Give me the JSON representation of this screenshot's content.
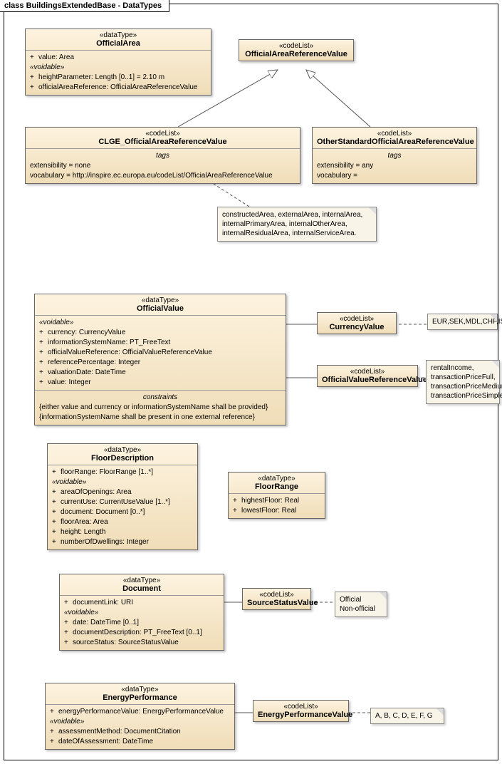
{
  "frame": {
    "title": "class BuildingsExtendedBase - DataTypes"
  },
  "officialArea": {
    "stereo": "«dataType»",
    "name": "OfficialArea",
    "attrs": [
      "value: Area"
    ],
    "voidableLabel": "«voidable»",
    "voidable": [
      "heightParameter: Length [0..1] = 2.10 m",
      "officialAreaReference: OfficialAreaReferenceValue"
    ]
  },
  "oarv": {
    "stereo": "«codeList»",
    "name": "OfficialAreaReferenceValue"
  },
  "clge": {
    "stereo": "«codeList»",
    "name": "CLGE_OfficialAreaReferenceValue",
    "tagsLabel": "tags",
    "tags": [
      "extensibility = none",
      "vocabulary = http://inspire.ec.europa.eu/codeList/OfficialAreaReferenceValue"
    ]
  },
  "other": {
    "stereo": "«codeList»",
    "name": "OtherStandardOfficialAreaReferenceValue",
    "tagsLabel": "tags",
    "tags": [
      "extensibility = any",
      "vocabulary ="
    ]
  },
  "areaNote": "constructedArea, externalArea, internalArea, internalPrimaryArea, internalOtherArea, internalResidualArea, internalServiceArea.",
  "officialValue": {
    "stereo": "«dataType»",
    "name": "OfficialValue",
    "voidableLabel": "«voidable»",
    "voidable": [
      "currency: CurrencyValue",
      "informationSystemName: PT_FreeText",
      "officialValueReference: OfficialValueReferenceValue",
      "referencePercentage: Integer",
      "valuationDate: DateTime",
      "value: Integer"
    ],
    "constraintsLabel": "constraints",
    "constraints": [
      "{either value and currency or informationSystemName shall be provided}",
      "{informationSystemName shall be present in one external reference}"
    ]
  },
  "currency": {
    "stereo": "«codeList»",
    "name": "CurrencyValue"
  },
  "currencyNote": "EUR,SEK,MDL,CHF,ISK,GBP,RUB,RSD",
  "ovrv": {
    "stereo": "«codeList»",
    "name": "OfficialValueReferenceValue"
  },
  "ovrvNote": "rentalIncome, transactionPriceFull, transactionPriceMedium, transactionPriceSimple",
  "floorDesc": {
    "stereo": "«dataType»",
    "name": "FloorDescription",
    "attrs": [
      "floorRange: FloorRange [1..*]"
    ],
    "voidableLabel": "«voidable»",
    "voidable": [
      "areaOfOpenings: Area",
      "currentUse: CurrentUseValue [1..*]",
      "document: Document [0..*]",
      "floorArea: Area",
      "height: Length",
      "numberOfDwellings: Integer"
    ]
  },
  "floorRange": {
    "stereo": "«dataType»",
    "name": "FloorRange",
    "attrs": [
      "highestFloor: Real",
      "lowestFloor: Real"
    ]
  },
  "document": {
    "stereo": "«dataType»",
    "name": "Document",
    "attrs": [
      "documentLink: URI"
    ],
    "voidableLabel": "«voidable»",
    "voidable": [
      "date: DateTime [0..1]",
      "documentDescription: PT_FreeText [0..1]",
      "sourceStatus: SourceStatusValue"
    ]
  },
  "sourceStatus": {
    "stereo": "«codeList»",
    "name": "SourceStatusValue"
  },
  "sourceNote": "Official\nNon-official",
  "energy": {
    "stereo": "«dataType»",
    "name": "EnergyPerformance",
    "attrs": [
      "energyPerformanceValue: EnergyPerformanceValue"
    ],
    "voidableLabel": "«voidable»",
    "voidable": [
      "assessmentMethod: DocumentCitation",
      "dateOfAssessment: DateTime"
    ]
  },
  "energyVal": {
    "stereo": "«codeList»",
    "name": "EnergyPerformanceValue"
  },
  "energyNote": "A, B, C, D, E, F, G"
}
